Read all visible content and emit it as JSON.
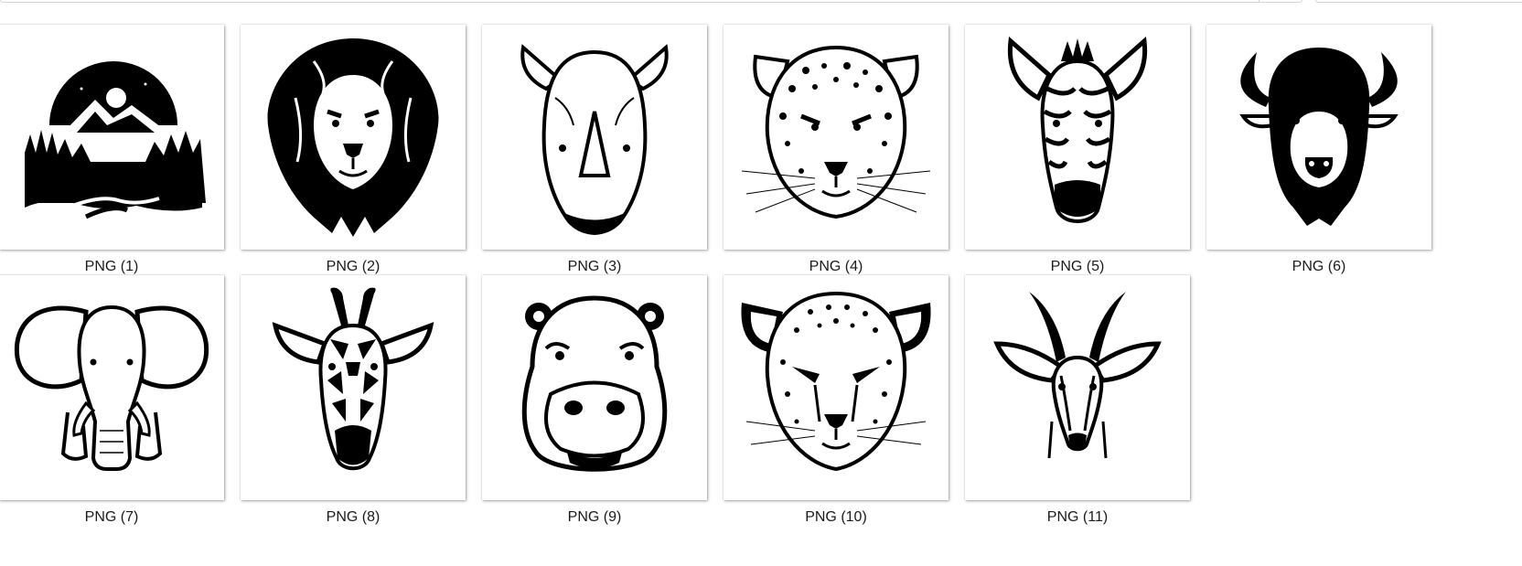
{
  "files": [
    {
      "label": "PNG (1)",
      "subject": "mountain-forest-landscape"
    },
    {
      "label": "PNG (2)",
      "subject": "lion-head"
    },
    {
      "label": "PNG (3)",
      "subject": "rhino-head"
    },
    {
      "label": "PNG (4)",
      "subject": "leopard-head"
    },
    {
      "label": "PNG (5)",
      "subject": "zebra-head"
    },
    {
      "label": "PNG (6)",
      "subject": "bison-head"
    },
    {
      "label": "PNG (7)",
      "subject": "elephant-head"
    },
    {
      "label": "PNG (8)",
      "subject": "giraffe-head"
    },
    {
      "label": "PNG (9)",
      "subject": "hippo-head"
    },
    {
      "label": "PNG (10)",
      "subject": "cheetah-head"
    },
    {
      "label": "PNG (11)",
      "subject": "gazelle-head"
    }
  ],
  "colors": {
    "ink": "#000000",
    "paper": "#ffffff",
    "caption": "#1a1a1a"
  }
}
